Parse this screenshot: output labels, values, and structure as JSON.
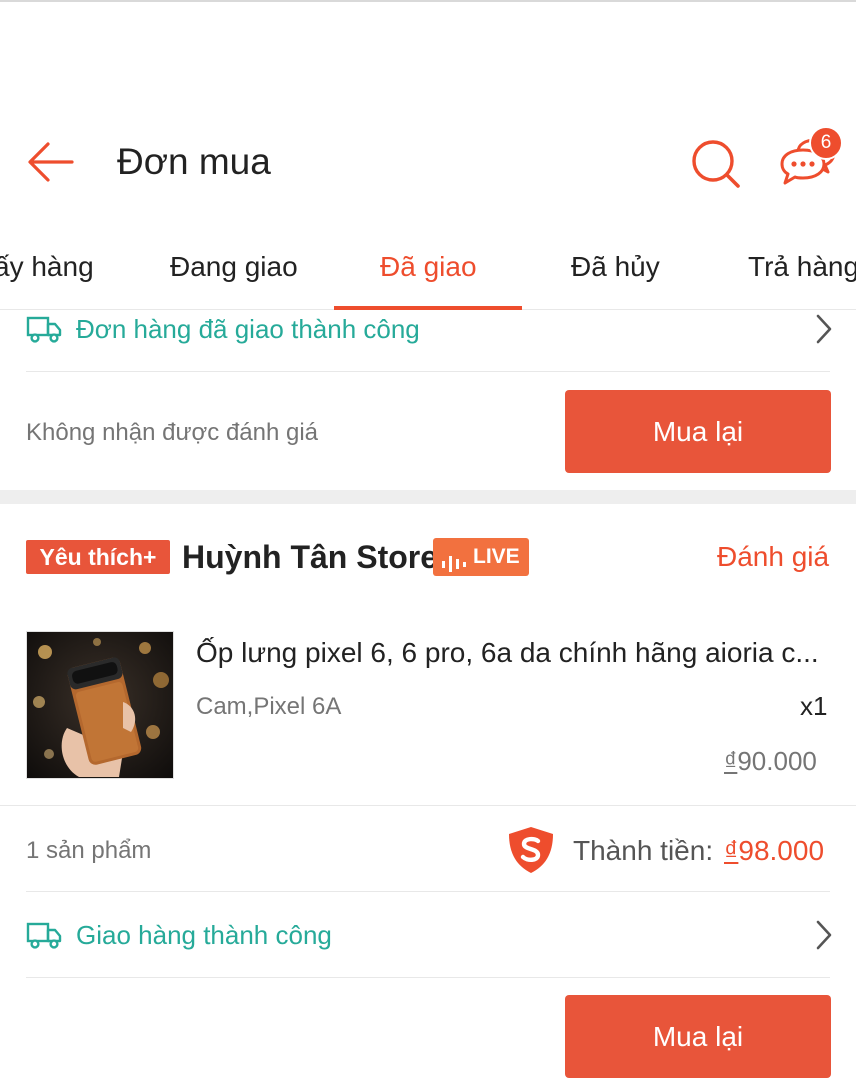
{
  "header": {
    "title": "Đơn mua",
    "chat_badge_count": "6"
  },
  "tabs": [
    {
      "label": "ấy hàng"
    },
    {
      "label": "Đang giao"
    },
    {
      "label": "Đã giao"
    },
    {
      "label": "Đã hủy"
    },
    {
      "label": "Trả hàng"
    }
  ],
  "order1": {
    "delivery_status": "Đơn hàng đã giao thành công",
    "review_note": "Không nhận được đánh giá",
    "rebuy_label": "Mua lại"
  },
  "order2": {
    "fav_badge": "Yêu thích+",
    "shop_name": "Huỳnh Tân Store",
    "live_label": "LIVE",
    "review_link": "Đánh giá",
    "product": {
      "name": "Ốp lưng pixel 6, 6 pro, 6a da chính hãng aioria c...",
      "variant": "Cam,Pixel 6A",
      "qty": "x1",
      "currency": "₫",
      "price": "90.000"
    },
    "item_count": "1 sản phẩm",
    "total_label": "Thành tiền:",
    "total_currency": "₫",
    "total_value": "98.000",
    "delivery_status": "Giao hàng thành công",
    "rebuy_label": "Mua lại"
  },
  "colors": {
    "brand": "#ee4d2d",
    "teal": "#26aa99",
    "button": "#e8553a"
  }
}
